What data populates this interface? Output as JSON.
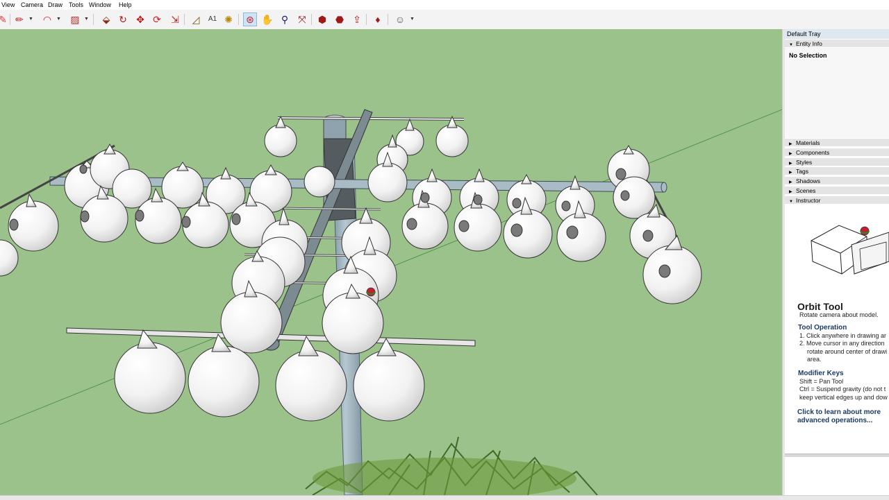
{
  "menu": [
    "View",
    "Camera",
    "Draw",
    "Tools",
    "Window",
    "Help"
  ],
  "toolbar": {
    "icons": [
      "eraser-icon",
      "pencil-icon",
      "arc-icon",
      "paint-bucket-icon",
      "push-pull-icon",
      "follow-me-icon",
      "move-icon",
      "rotate-icon",
      "scale-icon",
      "tape-measure-icon",
      "text-icon",
      "paint-icon",
      "orbit-icon",
      "pan-icon",
      "zoom-icon",
      "zoom-extents-icon",
      "warehouse-icon",
      "extension-icon",
      "share-icon",
      "ruby-icon",
      "user-icon"
    ],
    "active_tool": "Orbit Tool"
  },
  "tray": {
    "title": "Default Tray",
    "entity_info": {
      "label": "Entity Info",
      "value": "No Selection"
    },
    "panels": [
      "Materials",
      "Components",
      "Styles",
      "Tags",
      "Shadows",
      "Scenes",
      "Instructor"
    ],
    "instructor": {
      "title": "Orbit Tool",
      "subtitle": "Rotate camera about model.",
      "op_heading": "Tool Operation",
      "op_1": "1. Click anywhere in drawing ar",
      "op_2a": "2. Move cursor in any direction",
      "op_2b": "rotate around center of drawi",
      "op_2c": "area.",
      "mod_heading": "Modifier Keys",
      "mod_1": "Shift = Pan Tool",
      "mod_2a": "Ctrl = Suspend gravity (do not t",
      "mod_2b": "keep vertical edges up and dow",
      "link_1": "Click to learn about more",
      "link_2": "advanced operations..."
    }
  },
  "colors": {
    "viewport_bg": "#9cc28c",
    "pole": "#9aaeb8",
    "gourd": "#f7f7f7"
  }
}
